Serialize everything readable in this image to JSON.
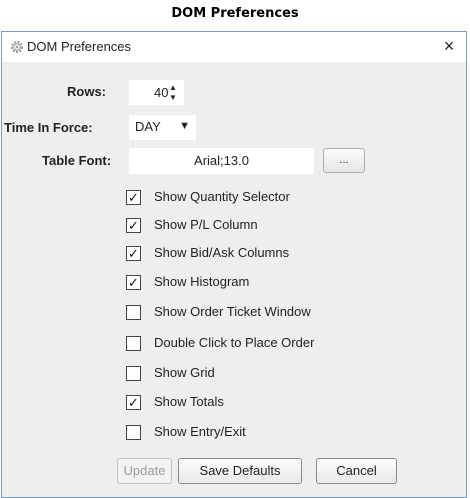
{
  "caption": "DOM Preferences",
  "window": {
    "title": "DOM Preferences",
    "close_glyph": "×"
  },
  "rows": {
    "label": "Rows:",
    "value": "40"
  },
  "time_in_force": {
    "label": "Time In Force:",
    "value": "DAY"
  },
  "table_font": {
    "label": "Table Font:",
    "value": "Arial;13.0",
    "button_label": "..."
  },
  "checkboxes": [
    {
      "label": "Show Quantity Selector",
      "checked": true
    },
    {
      "label": "Show P/L Column",
      "checked": true
    },
    {
      "label": "Show Bid/Ask Columns",
      "checked": true
    },
    {
      "label": "Show Histogram",
      "checked": true
    },
    {
      "label": "Show Order Ticket Window",
      "checked": false
    },
    {
      "label": "Double Click to Place Order",
      "checked": false
    },
    {
      "label": "Show Grid",
      "checked": false
    },
    {
      "label": "Show Totals",
      "checked": true
    },
    {
      "label": "Show Entry/Exit",
      "checked": false
    }
  ],
  "buttons": {
    "update": "Update",
    "save_defaults": "Save Defaults",
    "cancel": "Cancel"
  },
  "icons": {
    "title": "gear-icon",
    "close": "close-icon"
  },
  "colors": {
    "window_border": "#7a9cc7",
    "panel_bg": "#eeeeee"
  }
}
